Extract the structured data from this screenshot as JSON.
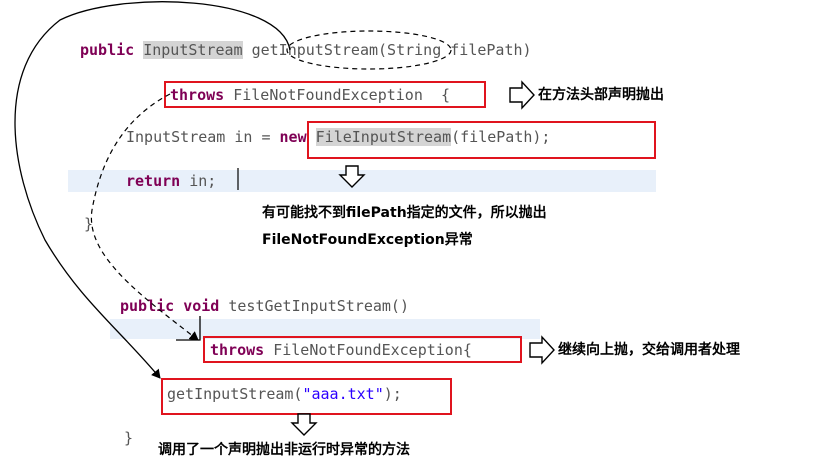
{
  "method1": {
    "sig_public": "public",
    "sig_type": "InputStream",
    "sig_name": "getInputStream",
    "sig_params": "(String filePath)",
    "throws_kw": "throws",
    "throws_exc": "FileNotFoundException",
    "brace_open": "{",
    "body1_prefix": "InputStream in =",
    "body1_new": "new",
    "body1_class": "FileInputStream",
    "body1_args": "(filePath);",
    "return_kw": "return",
    "return_rest": "in;",
    "brace_close": "}"
  },
  "method2": {
    "sig_public": "public",
    "sig_void": "void",
    "sig_name": "testGetInputStream()",
    "throws_kw": "throws",
    "throws_exc": "FileNotFoundException",
    "brace_open": "{",
    "call_name": "getInputStream(",
    "call_arg": "\"aaa.txt\"",
    "call_end": ");",
    "brace_close": "}"
  },
  "notes": {
    "declare_in_header": "在方法头部声明抛出",
    "may_not_find_line1": "有可能找不到filePath指定的文件，所以抛出",
    "may_not_find_line2": "FileNotFoundException异常",
    "propagate_up": "继续向上抛，交给调用者处理",
    "called_method": "调用了一个声明抛出非运行时异常的方法"
  },
  "colors": {
    "keyword": "#7f0055",
    "string": "#2a00ff",
    "box": "#e0141e",
    "line_highlight": "#e8f0fa"
  }
}
